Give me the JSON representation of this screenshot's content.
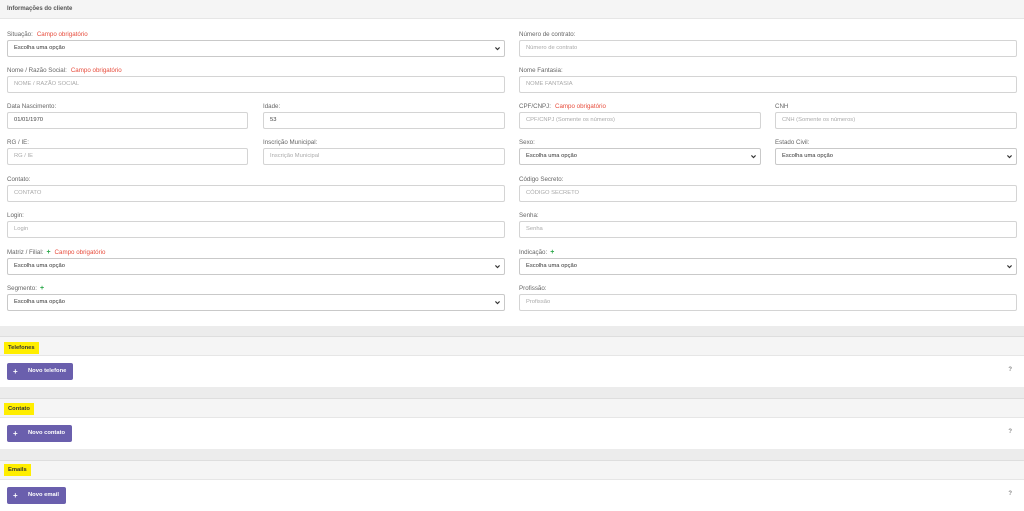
{
  "client_info": {
    "title": "Informações do cliente",
    "required_text": "Campo obrigatório",
    "fields": {
      "situacao": {
        "label": "Situação:",
        "value": "Escolha uma opção"
      },
      "numero_contrato": {
        "label": "Número de contrato:",
        "placeholder": "Número de contrato"
      },
      "nome": {
        "label": "Nome / Razão Social:",
        "placeholder": "NOME / RAZÃO SOCIAL"
      },
      "nome_fantasia": {
        "label": "Nome Fantasia:",
        "placeholder": "NOME FANTASIA"
      },
      "data_nascimento": {
        "label": "Data Nascimento:",
        "value": "01/01/1970"
      },
      "idade": {
        "label": "Idade:",
        "value": "53"
      },
      "cpf": {
        "label": "CPF/CNPJ:",
        "placeholder": "CPF/CNPJ (Somente os números)"
      },
      "cnh": {
        "label": "CNH",
        "placeholder": "CNH (Somente os números)"
      },
      "rg": {
        "label": "RG / IE:",
        "placeholder": "RG / IE"
      },
      "inscricao_municipal": {
        "label": "Inscrição Municipal:",
        "placeholder": "Inscrição Municipal"
      },
      "sexo": {
        "label": "Sexo:",
        "value": "Escolha uma opção"
      },
      "estado_civil": {
        "label": "Estado Civil:",
        "value": "Escolha uma opção"
      },
      "contato": {
        "label": "Contato:",
        "placeholder": "CONTATO"
      },
      "codigo_secreto": {
        "label": "Código Secreto:",
        "placeholder": "CÓDIGO SECRETO"
      },
      "login": {
        "label": "Login:",
        "placeholder": "Login"
      },
      "senha": {
        "label": "Senha:",
        "placeholder": "Senha"
      },
      "matriz": {
        "label": "Matriz / Filial:",
        "value": "Escolha uma opção"
      },
      "indicacao": {
        "label": "Indicação:",
        "value": "Escolha uma opção"
      },
      "segmento": {
        "label": "Segmento:",
        "value": "Escolha uma opção"
      },
      "profissao": {
        "label": "Profissão:",
        "placeholder": "Profissão"
      }
    }
  },
  "sections": {
    "telefones": {
      "title": "Telefones",
      "button": "Novo telefone",
      "help": "?"
    },
    "contato": {
      "title": "Contato",
      "button": "Novo contato",
      "help": "?"
    },
    "emails": {
      "title": "Emails",
      "button": "Novo email",
      "help": "?"
    }
  },
  "colors": {
    "required": "#e74c3c",
    "button": "#6a5fad",
    "highlight": "#ffee00",
    "plus": "#2ba84a"
  }
}
